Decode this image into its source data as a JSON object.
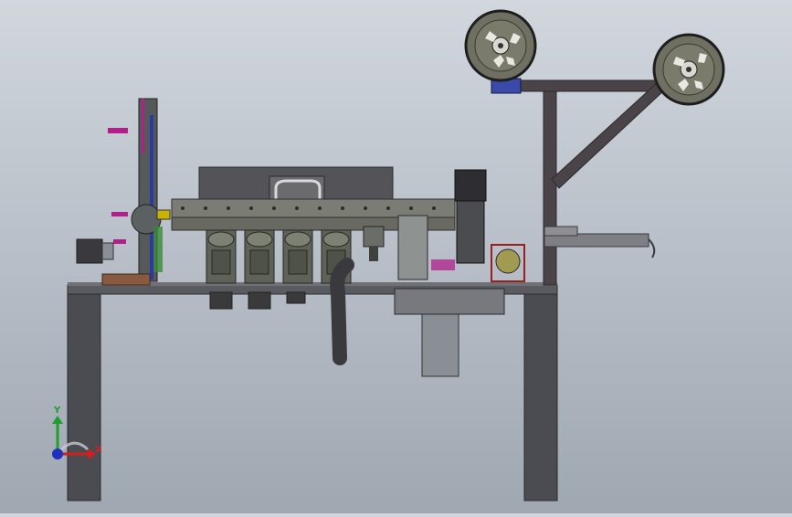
{
  "triad": {
    "x_label": "X",
    "y_label": "Y",
    "x_color": "#d11f1f",
    "y_color": "#1f9e2e",
    "z_color": "#1f2fbf",
    "origin_color": "#1f2fbf"
  },
  "colors": {
    "frame": "#4e4e55",
    "frame_dark": "#3f3f46",
    "plate": "#5a5a5a",
    "mech": "#6b6f66",
    "reel": "#6f7061",
    "reel_rim": "#2a2a2a",
    "accent_magenta": "#b0208a",
    "accent_blue": "#2a3aa0",
    "accent_green": "#3c8a3c",
    "accent_yellow": "#c9b200",
    "motor": "#8a8f96",
    "copper": "#8a5a40"
  }
}
